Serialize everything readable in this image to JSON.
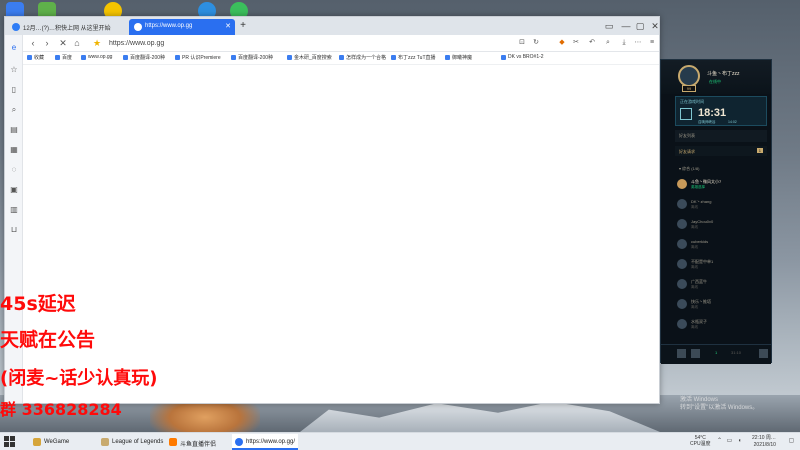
{
  "browser": {
    "tabs": [
      {
        "label": "12月…(?)…积快上网 从这里开始"
      },
      {
        "label": "https://www.op.gg"
      }
    ],
    "new_tab": "+",
    "url": "https://www.op.gg",
    "window_controls": [
      "▭",
      "—",
      "▢",
      "✕"
    ],
    "bookmarks": [
      "收藏",
      "百度",
      "www.op.gg",
      "百度翻译-200种",
      "PR 认识Premiere",
      "百度翻译-200种",
      "金木研_百度搜索",
      "怎样成为一个合格",
      "布丁zzz TuT直播",
      "御曦神魔",
      "DK vs BRO#1-2"
    ],
    "colors": {
      "tab_active": "#2a6ff0"
    }
  },
  "overlay": {
    "delay": "45s延迟",
    "talent": "天赋在公告",
    "mic": "(闭麦~话少认真玩)",
    "group": "群  336828284",
    "color": "#ff0a0a"
  },
  "client": {
    "name": "斗鱼丶布丁zzz",
    "status": "在线中",
    "level": "99",
    "ingame_label": "正在游戏时间",
    "ingame_time": "18:31",
    "ingame_sub": "召唤师峡谷",
    "ingame_sub2": "14:02",
    "friends_title": "好友列表",
    "friend_requests": "好友请求",
    "friend_requests_count": "1",
    "group_label": "▾ 综合 (1/8)",
    "friends": [
      {
        "name": "斗鱼丶微风太小7",
        "status": "英雄选择",
        "online": true
      },
      {
        "name": "DK丶zhang",
        "status": "离线",
        "online": false
      },
      {
        "name": "JayChou0v0",
        "status": "离线",
        "online": false
      },
      {
        "name": "cuberkids",
        "status": "离线",
        "online": false
      },
      {
        "name": "不配是中单1",
        "status": "离线",
        "online": false
      },
      {
        "name": "广西蓝牛",
        "status": "离线",
        "online": false
      },
      {
        "name": "快乐丶推塔",
        "status": "离线",
        "online": false
      },
      {
        "name": "水瓶双子",
        "status": "离线",
        "online": false
      }
    ],
    "footer_count": "1",
    "footer_time": "31:10"
  },
  "activate_windows": [
    "激活 Windows",
    "转到\"设置\"以激活 Windows。"
  ],
  "taskbar": {
    "items": [
      {
        "label": "WeGame",
        "color": "#d6a53a"
      },
      {
        "label": "League of Legends",
        "color": "#c8aa6e"
      },
      {
        "label": "斗鱼直播伴侣",
        "color": "#ff7a00"
      },
      {
        "label": "https://www.op.gg/",
        "color": "#2a6ff0",
        "active": true
      }
    ],
    "temp": "54°C",
    "temp_label": "CPU温度",
    "time": "22:10 周…",
    "date": "2021/8/10"
  }
}
